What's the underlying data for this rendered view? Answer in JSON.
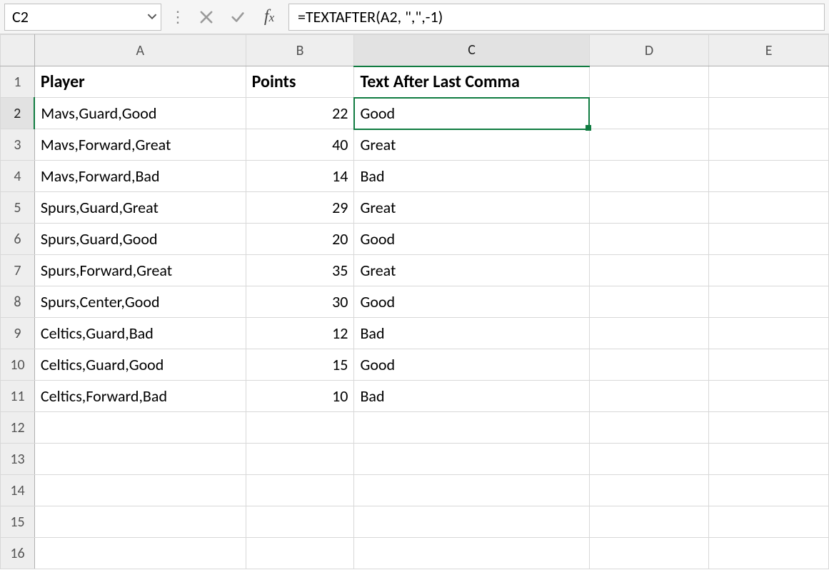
{
  "name_box": {
    "value": "C2"
  },
  "formula_bar": {
    "value": "=TEXTAFTER(A2, \",\",-1)"
  },
  "columns": [
    "A",
    "B",
    "C",
    "D",
    "E"
  ],
  "row_numbers": [
    1,
    2,
    3,
    4,
    5,
    6,
    7,
    8,
    9,
    10,
    11,
    12,
    13,
    14,
    15,
    16
  ],
  "headers": {
    "A": "Player",
    "B": "Points",
    "C": "Text After Last Comma"
  },
  "rows": [
    {
      "A": "Mavs,Guard,Good",
      "B": 22,
      "C": "Good"
    },
    {
      "A": "Mavs,Forward,Great",
      "B": 40,
      "C": "Great"
    },
    {
      "A": "Mavs,Forward,Bad",
      "B": 14,
      "C": "Bad"
    },
    {
      "A": "Spurs,Guard,Great",
      "B": 29,
      "C": "Great"
    },
    {
      "A": "Spurs,Guard,Good",
      "B": 20,
      "C": "Good"
    },
    {
      "A": "Spurs,Forward,Great",
      "B": 35,
      "C": "Great"
    },
    {
      "A": "Spurs,Center,Good",
      "B": 30,
      "C": "Good"
    },
    {
      "A": "Celtics,Guard,Bad",
      "B": 12,
      "C": "Bad"
    },
    {
      "A": "Celtics,Guard,Good",
      "B": 15,
      "C": "Good"
    },
    {
      "A": "Celtics,Forward,Bad",
      "B": 10,
      "C": "Bad"
    }
  ],
  "selection": {
    "cell": "C2",
    "row": 2,
    "col": "C"
  },
  "chart_data": {
    "type": "table",
    "title": "",
    "columns": [
      "Player",
      "Points",
      "Text After Last Comma"
    ],
    "rows": [
      [
        "Mavs,Guard,Good",
        22,
        "Good"
      ],
      [
        "Mavs,Forward,Great",
        40,
        "Great"
      ],
      [
        "Mavs,Forward,Bad",
        14,
        "Bad"
      ],
      [
        "Spurs,Guard,Great",
        29,
        "Great"
      ],
      [
        "Spurs,Guard,Good",
        20,
        "Good"
      ],
      [
        "Spurs,Forward,Great",
        35,
        "Great"
      ],
      [
        "Spurs,Center,Good",
        30,
        "Good"
      ],
      [
        "Celtics,Guard,Bad",
        12,
        "Bad"
      ],
      [
        "Celtics,Guard,Good",
        15,
        "Good"
      ],
      [
        "Celtics,Forward,Bad",
        10,
        "Bad"
      ]
    ]
  }
}
